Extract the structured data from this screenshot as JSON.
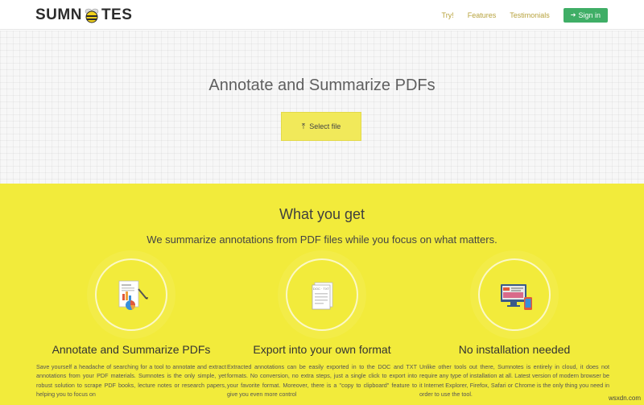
{
  "header": {
    "logo_left": "SUMN",
    "logo_right": "TES",
    "nav": [
      "Try!",
      "Features",
      "Testimonials"
    ],
    "signin_label": "Sign in",
    "signin_icon": "sign-in-icon"
  },
  "hero": {
    "title": "Annotate and Summarize PDFs",
    "button_label": "Select file",
    "button_icon": "upload-icon"
  },
  "section": {
    "title": "What you get",
    "subtitle": "We summarize annotations from PDF files while you focus on what matters.",
    "features": [
      {
        "icon": "document-chart-icon",
        "title": "Annotate and Summarize PDFs",
        "text": "Save yourself a headache of searching for a tool to annotate and extract annotations from your PDF materials. Sumnotes is the only simple, yet robust solution to scrape PDF books, lecture notes or research papers, helping you to focus on"
      },
      {
        "icon": "doc-txt-file-icon",
        "title": "Export into your own format",
        "text": "Extracted annotations can be easily exported in to the DOC and TXT formats. No conversion, no extra steps, just a single click to export into your favorite format. Moreover, there is a \"copy to clipboard\" feature to give you even more control"
      },
      {
        "icon": "devices-icon",
        "title": "No installation needed",
        "text": "Unlike other tools out there, Sumnotes is entirely in cloud, it does not require any type of installation at all. Latest version of modern browser be it Internet Explorer, Firefox, Safari or Chrome is the only thing you need in order to use the tool."
      }
    ]
  },
  "watermark": "wsxdn.com",
  "colors": {
    "accent_yellow": "#f2eb3b",
    "button_yellow": "#f1e95a",
    "signin_green": "#3fae66",
    "nav_text": "#b7a23d"
  }
}
